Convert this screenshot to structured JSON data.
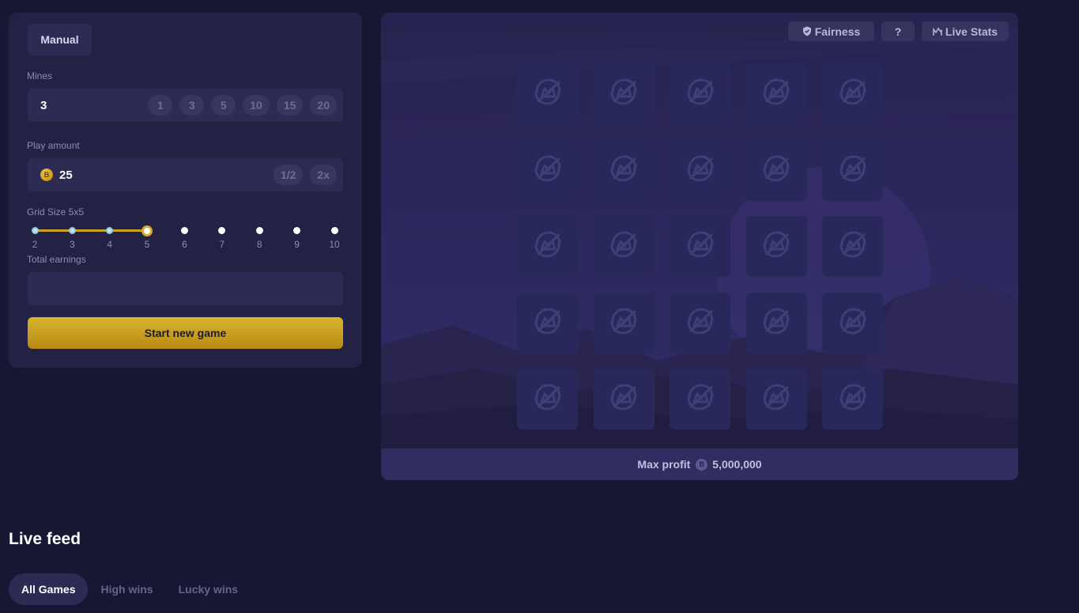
{
  "controls": {
    "mode_tab": "Manual",
    "mines": {
      "label": "Mines",
      "value": "3",
      "presets": [
        "1",
        "3",
        "5",
        "10",
        "15",
        "20"
      ]
    },
    "play_amount": {
      "label": "Play amount",
      "coin_symbol": "B",
      "value": "25",
      "buttons": [
        "1/2",
        "2x"
      ]
    },
    "grid_size": {
      "label": "Grid Size 5x5",
      "ticks": [
        "2",
        "3",
        "4",
        "5",
        "6",
        "7",
        "8",
        "9",
        "10"
      ],
      "selected": "5"
    },
    "total_earnings": {
      "label": "Total earnings",
      "value": ""
    },
    "start_button": "Start new game"
  },
  "board": {
    "fairness_label": "Fairness",
    "help_label": "?",
    "live_stats_label": "Live Stats",
    "rows": 5,
    "cols": 5,
    "tile_icon": "hidden-gem-icon",
    "max_profit_label": "Max profit",
    "max_profit_coin": "B",
    "max_profit_value": "5,000,000"
  },
  "live_feed": {
    "title": "Live feed",
    "tabs": [
      "All Games",
      "High wins",
      "Lucky wins"
    ],
    "active_tab": "All Games"
  },
  "colors": {
    "background": "#181733",
    "panel": "#232144",
    "accent_gold": "#d2ab2f",
    "tile": "#28285b"
  }
}
